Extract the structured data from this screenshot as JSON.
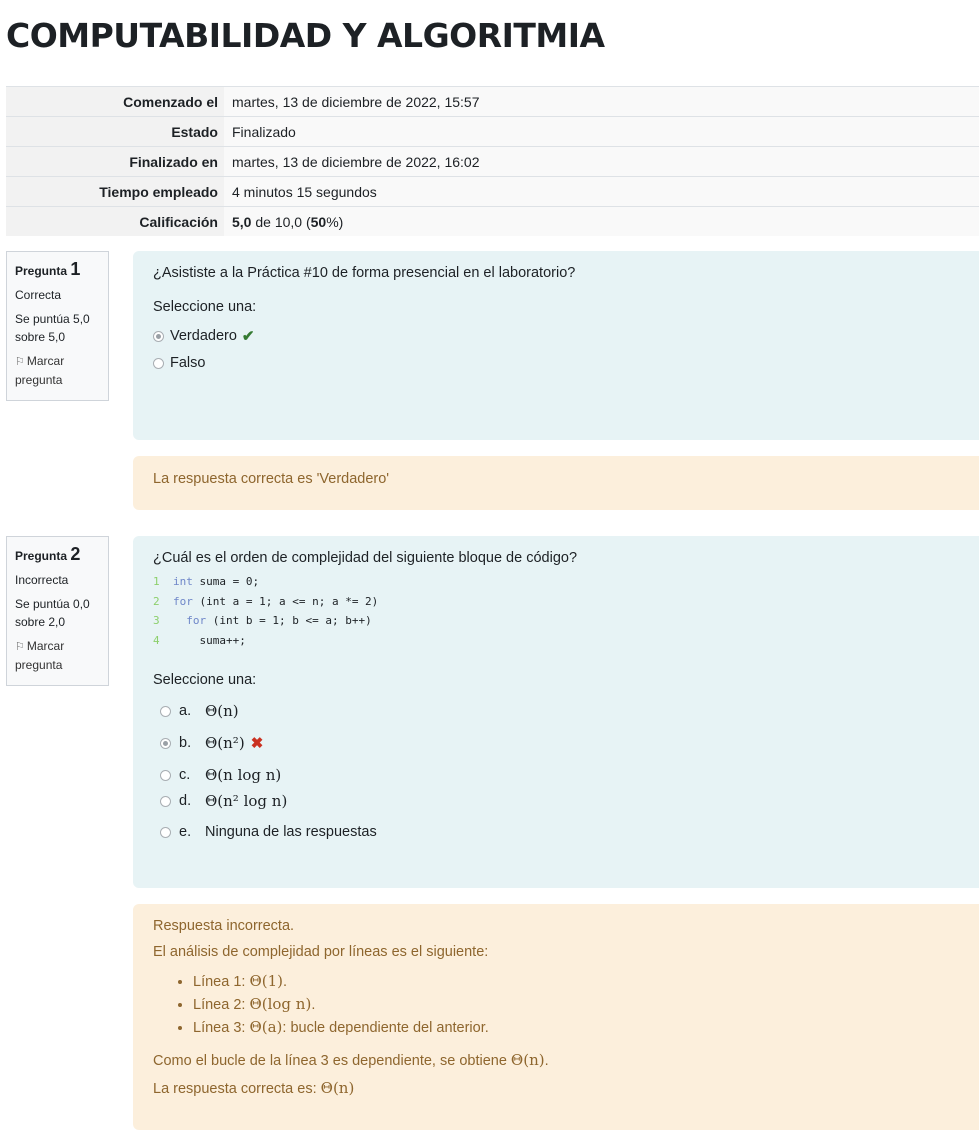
{
  "page": {
    "title": "COMPUTABILIDAD Y ALGORITMIA"
  },
  "summary": {
    "rows": [
      {
        "label": "Comenzado el",
        "value": "martes, 13 de diciembre de 2022, 15:57"
      },
      {
        "label": "Estado",
        "value": "Finalizado"
      },
      {
        "label": "Finalizado en",
        "value": "martes, 13 de diciembre de 2022, 16:02"
      },
      {
        "label": "Tiempo empleado",
        "value": "4 minutos 15 segundos"
      }
    ],
    "grade": {
      "label": "Calificación",
      "score": "5,0",
      "of": "de 10,0 (",
      "percent": "50",
      "pct_suffix": "%)"
    }
  },
  "q1": {
    "info": {
      "pregunta": "Pregunta",
      "number": "1",
      "state": "Correcta",
      "marks": "Se puntúa 5,0 sobre 5,0",
      "flag": "Marcar pregunta"
    },
    "text": "¿Asististe a la Práctica #10 de forma presencial en el laboratorio?",
    "prompt": "Seleccione una:",
    "options": [
      {
        "label": "Verdadero",
        "checked": true,
        "mark": "✔"
      },
      {
        "label": "Falso",
        "checked": false
      }
    ],
    "feedback": "La respuesta correcta es 'Verdadero'"
  },
  "q2": {
    "info": {
      "pregunta": "Pregunta",
      "number": "2",
      "state": "Incorrecta",
      "marks": "Se puntúa 0,0 sobre 2,0",
      "flag": "Marcar pregunta"
    },
    "text": "¿Cuál es el orden de complejidad del siguiente bloque de código?",
    "code": [
      {
        "n": "1",
        "kw": "int",
        "rest": " suma = 0;"
      },
      {
        "n": "2",
        "kw": "for",
        "rest": " (int a = 1; a <= n; a *= 2)"
      },
      {
        "n": "3",
        "kw": "  for",
        "rest": " (int b = 1; b <= a; b++)"
      },
      {
        "n": "4",
        "kw": "",
        "rest": "    suma++;"
      }
    ],
    "prompt": "Seleccione una:",
    "options": [
      {
        "letter": "a.",
        "label": "Θ(n)",
        "checked": false
      },
      {
        "letter": "b.",
        "label": "Θ(n²)",
        "checked": true,
        "mark": "✖"
      },
      {
        "letter": "c.",
        "label": "Θ(n log n)",
        "checked": false
      },
      {
        "letter": "d.",
        "label": "Θ(n² log n)",
        "checked": false
      },
      {
        "letter": "e.",
        "label": "Ninguna de las respuestas",
        "checked": false
      }
    ],
    "feedback": {
      "title": "Respuesta incorrecta.",
      "intro": "El análisis de complejidad por líneas es el siguiente:",
      "items": [
        {
          "prefix": "Línea 1: ",
          "math": "Θ(1)",
          "suffix": "."
        },
        {
          "prefix": "Línea 2: ",
          "math": "Θ(log n)",
          "suffix": "."
        },
        {
          "prefix": "Línea 3: ",
          "math": "Θ(a)",
          "suffix": ": bucle dependiente del anterior."
        }
      ],
      "conclusion_text": "Como el bucle de la línea 3 es dependiente, se obtiene ",
      "conclusion_math": "Θ(n)",
      "conclusion_end": ".",
      "answer_text": "La respuesta correcta es: ",
      "answer_math": "Θ(n)"
    }
  }
}
